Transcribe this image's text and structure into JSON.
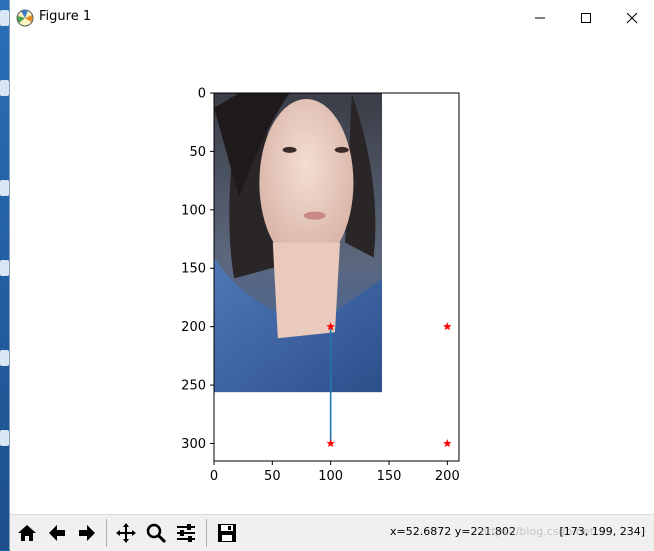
{
  "window": {
    "title": "Figure 1"
  },
  "toolbar": {
    "buttons": [
      "home-icon",
      "back-arrow-icon",
      "forward-arrow-icon",
      "pan-icon",
      "zoom-icon",
      "configure-subplots-icon",
      "save-icon"
    ],
    "coordinates": "x=52.6872  y=221.802",
    "pixel_value": "[173, 199, 234]",
    "watermark": "https://blog.csdn.net/..."
  },
  "chart_data": {
    "type": "scatter",
    "image": {
      "width": 144,
      "height": 256,
      "description": "photo of woman in denim jacket"
    },
    "x_ticks": [
      "0",
      "50",
      "100",
      "150",
      "200"
    ],
    "y_ticks": [
      "0",
      "50",
      "100",
      "150",
      "200",
      "250",
      "300"
    ],
    "xlim": [
      0,
      210
    ],
    "ylim": [
      315,
      0
    ],
    "points": [
      {
        "x": 100,
        "y": 200
      },
      {
        "x": 200,
        "y": 200
      },
      {
        "x": 100,
        "y": 300
      },
      {
        "x": 200,
        "y": 300
      }
    ],
    "line": {
      "x": [
        100,
        100
      ],
      "y": [
        200,
        300
      ],
      "color": "#1f77b4"
    },
    "marker_color": "#ff0000"
  }
}
